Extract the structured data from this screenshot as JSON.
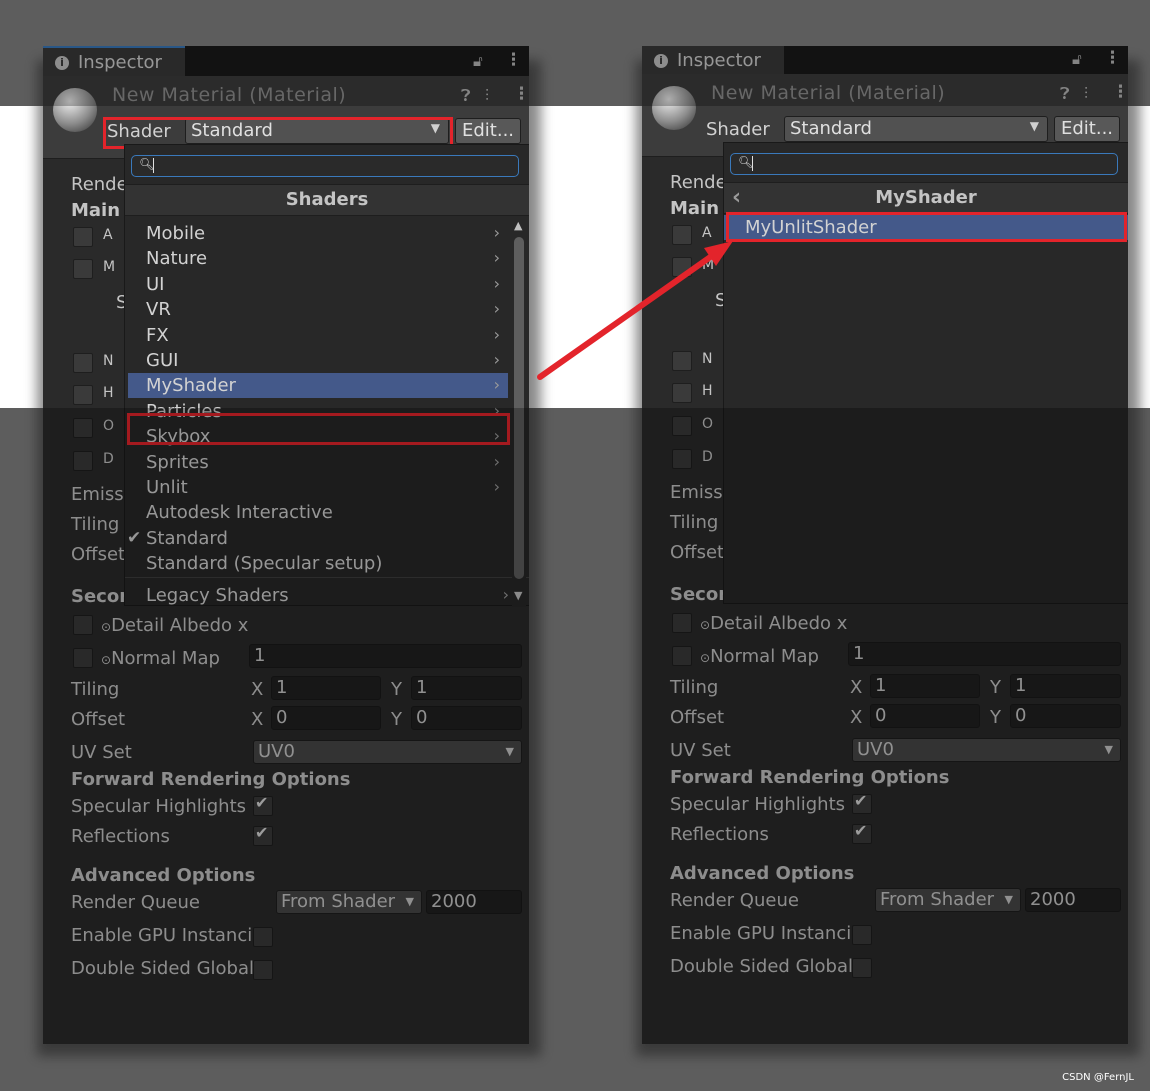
{
  "colors": {
    "selection_highlight": "#44598a",
    "annotation_red": "#e3242b",
    "search_focus_border": "#3a79bb",
    "panel_bg": "#2a2a2a"
  },
  "inspector": {
    "tab_title": "Inspector",
    "material_title": "New Material (Material)",
    "shader_label": "Shader",
    "shader_value": "Standard",
    "edit_button": "Edit...",
    "icons": [
      "info-icon",
      "lock-icon",
      "kebab-menu-icon",
      "help-icon",
      "preset-sliders-icon",
      "material-sphere-icon"
    ]
  },
  "properties": {
    "rendering_mode_trunc": "Rende",
    "main_maps_trunc": "Main I",
    "emission_trunc": "Emissi",
    "tiling_trunc": "Tiling",
    "offset_trunc": "Offset",
    "secondary_trunc": "Secon",
    "detail_albedo": "Detail Albedo x",
    "normal_map": "Normal Map",
    "normal_map_value": "1",
    "tiling": "Tiling",
    "offset": "Offset",
    "x_label": "X",
    "y_label": "Y",
    "tiling_x": "1",
    "tiling_y": "1",
    "offset_x": "0",
    "offset_y": "0",
    "uv_set": "UV Set",
    "uv_set_value": "UV0",
    "forward_rendering_options": "Forward Rendering Options",
    "specular_highlights": "Specular Highlights",
    "specular_highlights_checked": true,
    "reflections": "Reflections",
    "reflections_checked": true,
    "advanced_options": "Advanced Options",
    "render_queue": "Render Queue",
    "render_queue_mode": "From Shader",
    "render_queue_value": "2000",
    "gpu_instancing": "Enable GPU Instanci",
    "double_sided_gi": "Double Sided Global",
    "partial_letters": [
      "A",
      "M",
      "S",
      "N",
      "H",
      "O",
      "D"
    ]
  },
  "left_dropdown": {
    "search_value": "",
    "header": "Shaders",
    "items": [
      {
        "label": "Mobile",
        "submenu": true
      },
      {
        "label": "Nature",
        "submenu": true
      },
      {
        "label": "UI",
        "submenu": true
      },
      {
        "label": "VR",
        "submenu": true
      },
      {
        "label": "FX",
        "submenu": true
      },
      {
        "label": "GUI",
        "submenu": true
      },
      {
        "label": "MyShader",
        "submenu": true,
        "selected": true
      },
      {
        "label": "Particles",
        "submenu": true
      },
      {
        "label": "Skybox",
        "submenu": true
      },
      {
        "label": "Sprites",
        "submenu": true
      },
      {
        "label": "Unlit",
        "submenu": true
      },
      {
        "label": "Autodesk Interactive",
        "submenu": false
      },
      {
        "label": "Standard",
        "submenu": false,
        "checked": true
      },
      {
        "label": "Standard (Specular setup)",
        "submenu": false
      }
    ],
    "footer_item": "Legacy Shaders"
  },
  "right_dropdown": {
    "search_value": "",
    "header": "MyShader",
    "items": [
      {
        "label": "MyUnlitShader",
        "selected": true
      }
    ]
  },
  "watermark": "CSDN @FernJL"
}
